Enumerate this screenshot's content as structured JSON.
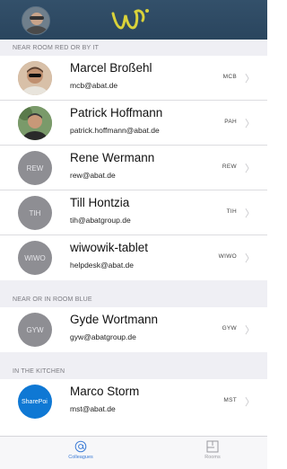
{
  "sections": [
    {
      "title": "NEAR ROOM RED OR BY IT",
      "people": [
        {
          "name": "Marcel Broßehl",
          "email": "mcb@abat.de",
          "code": "MCB",
          "initials": "",
          "photo": "photo-man-sunglasses"
        },
        {
          "name": "Patrick Hoffmann",
          "email": "patrick.hoffmann@abat.de",
          "code": "PAH",
          "initials": "",
          "photo": "photo-man-outdoor"
        },
        {
          "name": "Rene Wermann",
          "email": "rew@abat.de",
          "code": "REW",
          "initials": "REW"
        },
        {
          "name": "Till Hontzia",
          "email": "tih@abatgroup.de",
          "code": "TIH",
          "initials": "TIH"
        },
        {
          "name": "wiwowik-tablet",
          "email": "helpdesk@abat.de",
          "code": "WIWO",
          "initials": "WIWO"
        }
      ]
    },
    {
      "title": "NEAR OR IN ROOM BLUE",
      "people": [
        {
          "name": "Gyde Wortmann",
          "email": "gyw@abatgroup.de",
          "code": "GYW",
          "initials": "GYW"
        }
      ]
    },
    {
      "title": "IN THE KITCHEN",
      "people": [
        {
          "name": "Marco Storm",
          "email": "mst@abat.de",
          "code": "MST",
          "initials": "",
          "photo": "sharepoint-logo",
          "logo_text": "SharePoi"
        }
      ]
    }
  ],
  "tabs": [
    {
      "label": "Colleagues",
      "icon": "at-sign-icon",
      "active": true
    },
    {
      "label": "Rooms",
      "icon": "floorplan-icon",
      "active": false
    }
  ],
  "colors": {
    "header": "#2f4c66",
    "accent": "#3b7bd5",
    "logo": "#d9d23a",
    "avatar_gray": "#8e8e93"
  }
}
